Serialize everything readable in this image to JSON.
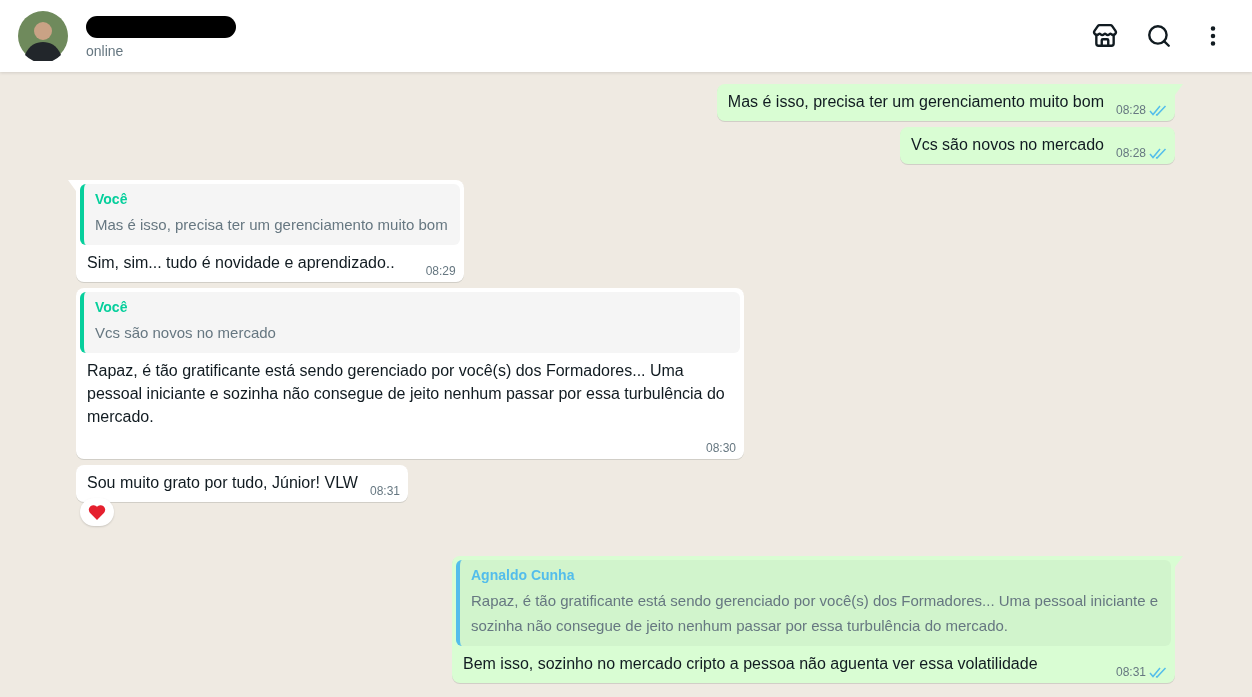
{
  "header": {
    "status": "online",
    "actions": [
      {
        "kind": "store"
      },
      {
        "kind": "search"
      },
      {
        "kind": "menu"
      }
    ]
  },
  "messages": [
    {
      "outgoing": true,
      "text": "Mas é isso, precisa ter um gerenciamento muito bom",
      "time": "08:28",
      "read": true
    },
    {
      "outgoing": true,
      "text": "Vcs são novos no mercado",
      "time": "08:28",
      "read": true
    },
    {
      "outgoing": false,
      "quote": {
        "author": "Você",
        "text": "Mas é isso, precisa ter um gerenciamento muito bom",
        "color": "#06cf9c"
      },
      "text": "Sim, sim... tudo é novidade e aprendizado..",
      "time": "08:29"
    },
    {
      "outgoing": false,
      "quote": {
        "author": "Você",
        "text": "Vcs são novos no mercado",
        "color": "#06cf9c"
      },
      "text": "Rapaz, é tão gratificante está sendo gerenciado por você(s) dos Formadores... Uma pessoal iniciante e sozinha não consegue de jeito nenhum passar por essa turbulência do mercado.",
      "time": "08:30"
    },
    {
      "outgoing": false,
      "text": "Sou muito grato por tudo, Júnior! VLW",
      "time": "08:31",
      "reaction": {
        "kind": "heart"
      }
    },
    {
      "outgoing": true,
      "quote": {
        "author": "Agnaldo Cunha",
        "text": "Rapaz, é tão gratificante está sendo gerenciado por você(s) dos Formadores... Uma pessoal iniciante e sozinha não consegue de jeito nenhum passar por essa turbulência do mercado.",
        "color": "#53bdeb"
      },
      "text": "Bem isso, sozinho no mercado cripto a pessoa não aguenta ver essa volatilidade",
      "time": "08:31",
      "read": true
    }
  ]
}
